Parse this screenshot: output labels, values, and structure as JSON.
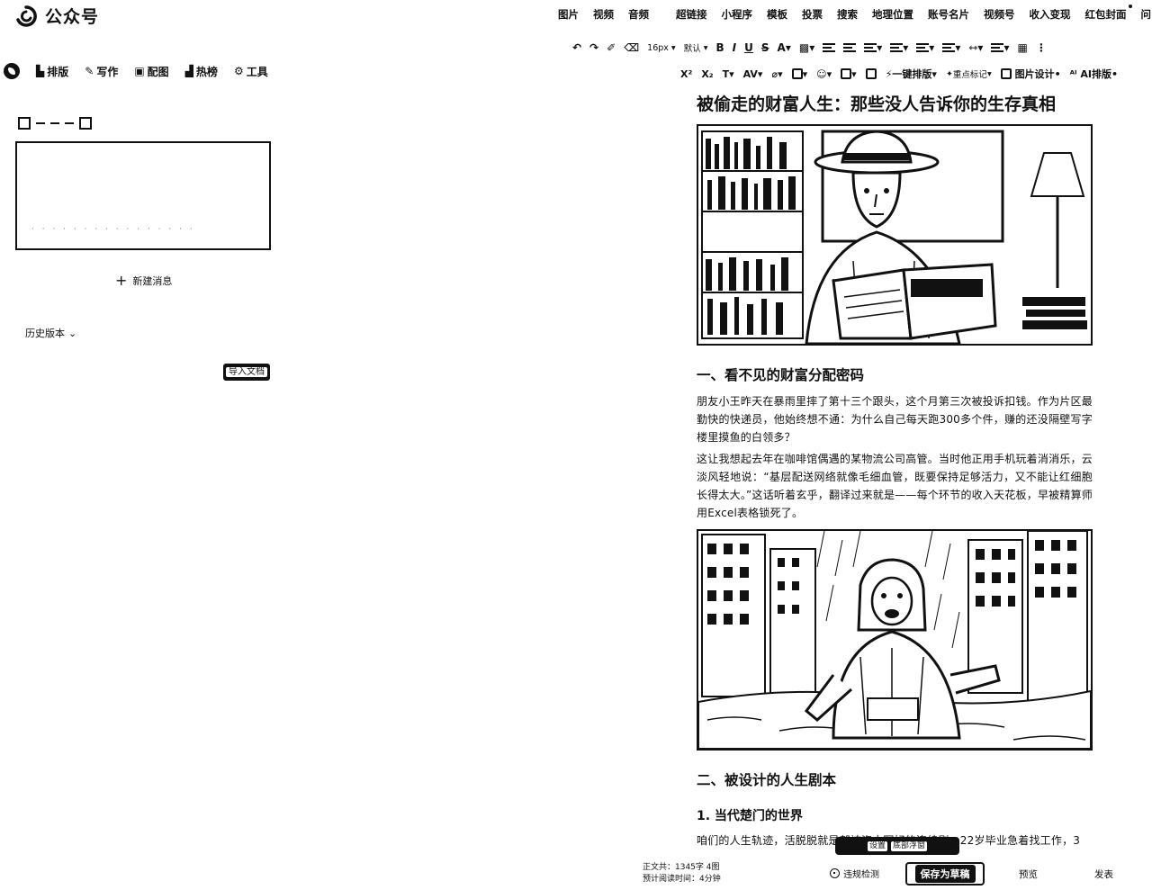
{
  "app": {
    "title": "公众号"
  },
  "insert_menu": [
    {
      "label": "图片",
      "dot": false
    },
    {
      "label": "视频",
      "dot": false
    },
    {
      "label": "音频",
      "dot": false
    },
    {
      "label": "超链接",
      "dot": false
    },
    {
      "label": "小程序",
      "dot": false
    },
    {
      "label": "模板",
      "dot": false
    },
    {
      "label": "投票",
      "dot": false
    },
    {
      "label": "搜索",
      "dot": false
    },
    {
      "label": "地理位置",
      "dot": false
    },
    {
      "label": "账号名片",
      "dot": false
    },
    {
      "label": "视频号",
      "dot": false
    },
    {
      "label": "收入变现",
      "dot": false
    },
    {
      "label": "红包封面",
      "dot": true
    },
    {
      "label": "问",
      "dot": false
    }
  ],
  "left_nav": {
    "items": [
      "排版",
      "写作",
      "配图",
      "热榜",
      "工具"
    ]
  },
  "left_panel": {
    "new_message": "新建消息",
    "history": "历史版本",
    "import_label": "导入文档"
  },
  "toolbar": {
    "font_size": "16px",
    "font_default": "默认",
    "one_click_layout": "一键排版",
    "focus_format": "重点标记",
    "image_design": "图片设计",
    "ai_layout": "AI排版"
  },
  "article": {
    "title": "被偷走的财富人生：那些没人告诉你的生存真相",
    "section1": "一、看不见的财富分配密码",
    "p1": "朋友小王昨天在暴雨里摔了第十三个跟头，这个月第三次被投诉扣钱。作为片区最勤快的快递员，他始终想不通：为什么自己每天跑300多个件，赚的还没隔壁写字楼里摸鱼的白领多？",
    "p2": "这让我想起去年在咖啡馆偶遇的某物流公司高管。当时他正用手机玩着消消乐，云淡风轻地说：“基层配送网络就像毛细血管，既要保持足够活力，又不能让红细胞长得太大。”这话听着玄乎，翻译过来就是——每个环节的收入天花板，早被精算师用Excel表格锁死了。",
    "section2": "二、被设计的人生剧本",
    "sub1": "1. 当代楚门的世界",
    "p3": "咱们的人生轨迹，活脱脱就是部被资本写好的连续剧。22岁毕业急着找工作，3"
  },
  "floating_tip": {
    "left": "设置",
    "right": "底部浮窗"
  },
  "footer": {
    "word_count": "正文共：1345字 4图",
    "read_time": "预计阅读时间：4分钟",
    "check": "违规检测",
    "save": "保存为草稿",
    "preview": "预览",
    "publish": "发表"
  }
}
